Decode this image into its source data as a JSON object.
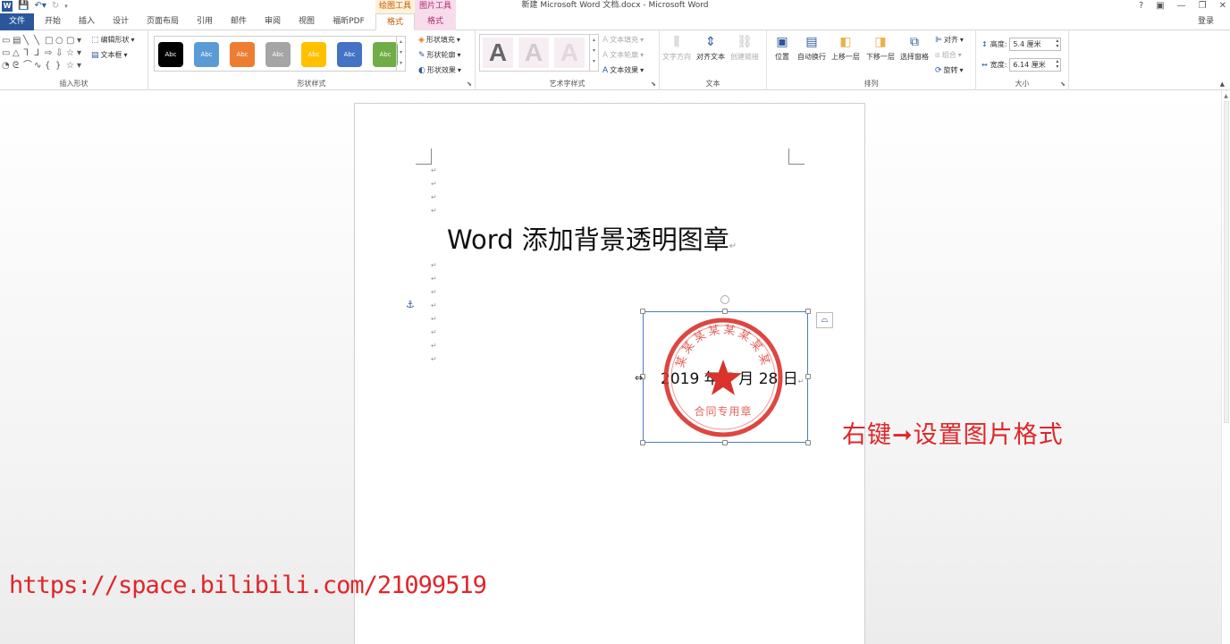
{
  "window": {
    "title": "新建 Microsoft Word 文档.docx - Microsoft Word",
    "context_groups": [
      "绘图工具",
      "图片工具"
    ],
    "controls": [
      "?",
      "▣",
      "—",
      "❐",
      "✕"
    ]
  },
  "tabs": {
    "file": "文件",
    "items": [
      "开始",
      "插入",
      "设计",
      "页面布局",
      "引用",
      "邮件",
      "审阅",
      "视图",
      "福昕PDF"
    ],
    "format_drawing": "格式",
    "format_picture": "格式",
    "login": "登录"
  },
  "ribbon": {
    "insert_shapes": {
      "label": "插入形状",
      "edit_shape": "编辑形状",
      "text_box": "文本框"
    },
    "shape_styles": {
      "label": "形状样式",
      "swatch_text": "Abc",
      "swatch_colors": [
        "#000000",
        "#5b9bd5",
        "#ed7d31",
        "#a5a5a5",
        "#ffc000",
        "#4472c4",
        "#70ad47"
      ],
      "fill": "形状填充",
      "outline": "形状轮廓",
      "effects": "形状效果"
    },
    "wordart_styles": {
      "label": "艺术字样式",
      "sample": "A",
      "text_fill": "文本填充",
      "text_outline": "文本轮廓",
      "text_effects": "文本效果"
    },
    "text": {
      "label": "文本",
      "direction": "文字方向",
      "align_text": "对齐文本",
      "create_link": "创建链接"
    },
    "arrange": {
      "label": "排列",
      "position": "位置",
      "wrap_text": "自动换行",
      "bring_forward": "上移一层",
      "send_backward": "下移一层",
      "selection_pane": "选择窗格",
      "align": "对齐",
      "group": "组合",
      "rotate": "旋转"
    },
    "size": {
      "label": "大小",
      "height_label": "高度:",
      "height_value": "5.4 厘米",
      "width_label": "宽度:",
      "width_value": "6.14 厘米"
    }
  },
  "document": {
    "heading": "Word 添加背景透明图章",
    "paragraph_mark": "↵",
    "date_text": "2019 年 7 月 28 日",
    "seal": {
      "top_text": "某某某某某某某某",
      "bottom_text": "合同专用章",
      "color": "#d9332c"
    }
  },
  "overlay": {
    "annotation": "右键➞设置图片格式",
    "url": "https://space.bilibili.com/21099519",
    "color": "#e0262a"
  }
}
